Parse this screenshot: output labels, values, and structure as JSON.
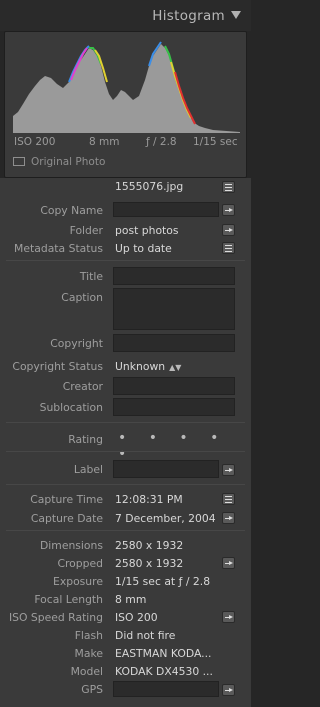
{
  "histogram": {
    "title": "Histogram",
    "iso": "ISO 200",
    "focal": "8 mm",
    "aperture": "ƒ / 2.8",
    "shutter": "1/15 sec",
    "original_photo_label": "Original Photo"
  },
  "metadata": {
    "filename": "1555076.jpg",
    "copy_name": {
      "label": "Copy Name",
      "value": ""
    },
    "folder": {
      "label": "Folder",
      "value": "post photos"
    },
    "metadata_status": {
      "label": "Metadata Status",
      "value": "Up to date"
    },
    "title": {
      "label": "Title",
      "value": ""
    },
    "caption": {
      "label": "Caption",
      "value": ""
    },
    "copyright": {
      "label": "Copyright",
      "value": ""
    },
    "copyright_status": {
      "label": "Copyright Status",
      "value": "Unknown"
    },
    "creator": {
      "label": "Creator",
      "value": ""
    },
    "sublocation": {
      "label": "Sublocation",
      "value": ""
    },
    "rating": {
      "label": "Rating",
      "value": "• • • • •"
    },
    "label": {
      "label": "Label",
      "value": ""
    },
    "capture_time": {
      "label": "Capture Time",
      "value": "12:08:31 PM"
    },
    "capture_date": {
      "label": "Capture Date",
      "value": "7 December, 2004"
    },
    "dimensions": {
      "label": "Dimensions",
      "value": "2580 x 1932"
    },
    "cropped": {
      "label": "Cropped",
      "value": "2580 x 1932"
    },
    "exposure": {
      "label": "Exposure",
      "value": "1/15 sec at ƒ / 2.8"
    },
    "focal_length": {
      "label": "Focal Length",
      "value": "8 mm"
    },
    "iso_speed": {
      "label": "ISO Speed Rating",
      "value": "ISO 200"
    },
    "flash": {
      "label": "Flash",
      "value": "Did not fire"
    },
    "make": {
      "label": "Make",
      "value": "EASTMAN KODA..."
    },
    "model": {
      "label": "Model",
      "value": "KODAK DX4530 ..."
    },
    "gps": {
      "label": "GPS",
      "value": ""
    }
  },
  "icons": {
    "collapse": "triangle-down-icon",
    "list": "list-icon",
    "go": "arrow-right-icon",
    "stepper": "up-down-icon"
  }
}
